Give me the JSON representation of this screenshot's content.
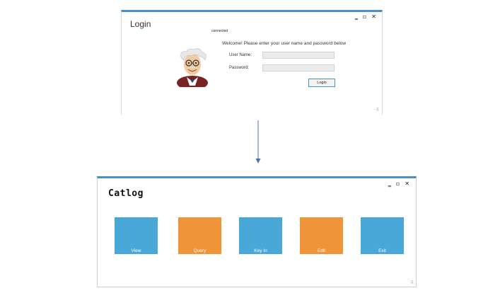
{
  "login_window": {
    "title": "Login",
    "status": "connected",
    "welcome": "Welcome! Please enter your user name and password below",
    "username_label": "User Name:",
    "username_value": "",
    "password_label": "Password:",
    "password_value": "",
    "login_button": "Login",
    "controls": {
      "minimize": "‗",
      "maximize": "▫",
      "close": "✕"
    },
    "avatar_icon": "professor-avatar-icon"
  },
  "catlog_window": {
    "title": "Catlog",
    "controls": {
      "minimize": "‗",
      "maximize": "▫",
      "close": "✕"
    },
    "tiles": [
      {
        "label": "View",
        "color": "#4aa8d8"
      },
      {
        "label": "Query",
        "color": "#f0943a"
      },
      {
        "label": "Key In",
        "color": "#4aa8d8"
      },
      {
        "label": "Edit",
        "color": "#f0943a"
      },
      {
        "label": "Exit",
        "color": "#4aa8d8"
      }
    ]
  },
  "colors": {
    "accent": "#4a90c8",
    "tile_blue": "#4aa8d8",
    "tile_orange": "#f0943a"
  }
}
